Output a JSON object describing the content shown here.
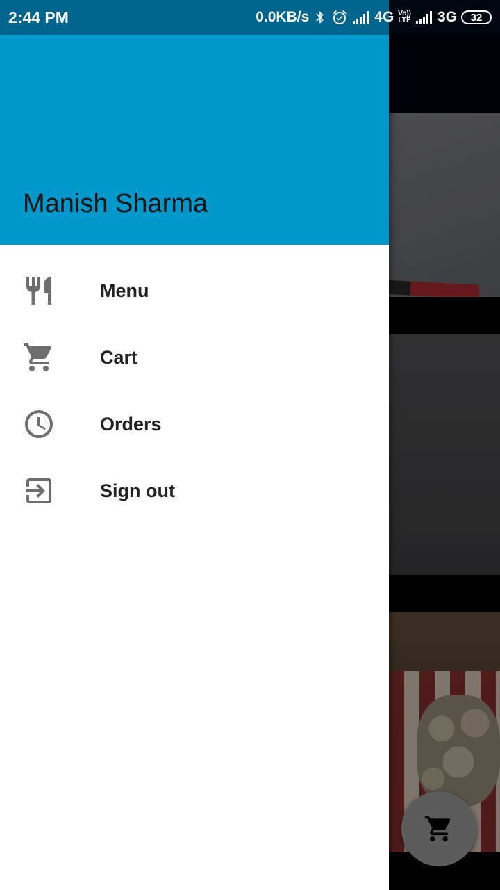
{
  "status_bar": {
    "time": "2:44 PM",
    "network_speed": "0.0KB/s",
    "network_1": "4G",
    "volte_top": "Vo))",
    "volte_bottom": "LTE",
    "network_2": "3G",
    "battery": "32",
    "icons": [
      "bluetooth-icon",
      "alarm-icon",
      "signal-icon",
      "signal-icon"
    ]
  },
  "drawer": {
    "header_color": "#0099cc",
    "user_name": "Manish Sharma",
    "items": [
      {
        "label": "Menu",
        "icon": "fork-knife-icon"
      },
      {
        "label": "Cart",
        "icon": "cart-icon"
      },
      {
        "label": "Orders",
        "icon": "clock-icon"
      },
      {
        "label": "Sign out",
        "icon": "exit-icon"
      }
    ]
  },
  "fab": {
    "icon": "cart-icon"
  },
  "colors": {
    "accent": "#0099cc",
    "status_bar": "#00658e",
    "icon_gray": "#6e6e6e"
  }
}
